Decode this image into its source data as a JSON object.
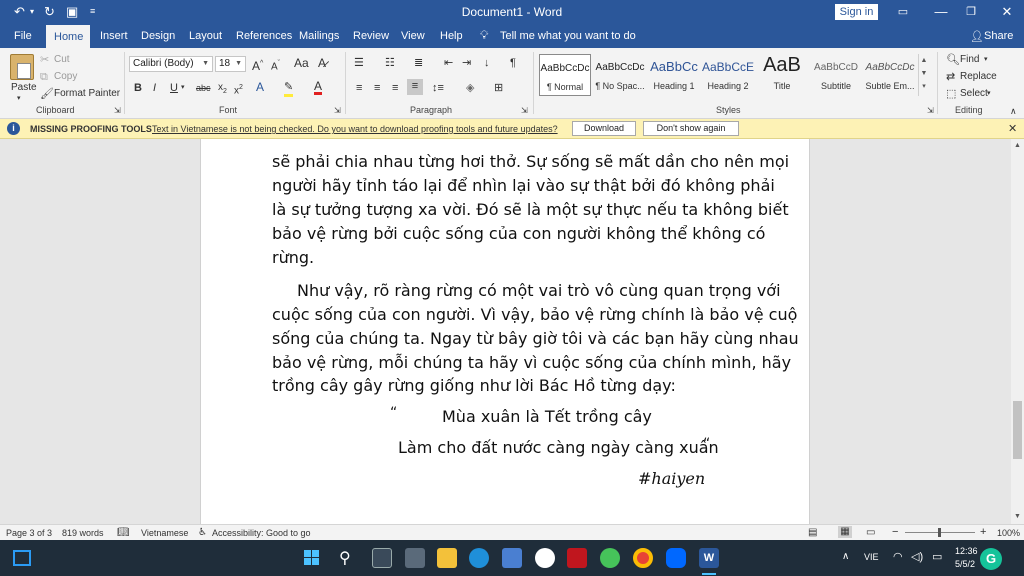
{
  "titlebar": {
    "title": "Document1 - Word",
    "signin_label": "Sign in"
  },
  "tabs": [
    "File",
    "Home",
    "Insert",
    "Design",
    "Layout",
    "References",
    "Mailings",
    "Review",
    "View",
    "Help"
  ],
  "tell_me": "Tell me what you want to do",
  "share_label": "Share",
  "clipboard": {
    "paste": "Paste",
    "cut": "Cut",
    "copy": "Copy",
    "format_painter": "Format Painter",
    "group_label": "Clipboard"
  },
  "font": {
    "family": "Calibri (Body)",
    "size": "18",
    "group_label": "Font"
  },
  "paragraph": {
    "group_label": "Paragraph"
  },
  "styles": {
    "items": [
      {
        "preview": "AaBbCcDc",
        "name": "¶ Normal"
      },
      {
        "preview": "AaBbCcDc",
        "name": "¶ No Spac..."
      },
      {
        "preview": "AaBbCc",
        "name": "Heading 1"
      },
      {
        "preview": "AaBbCcE",
        "name": "Heading 2"
      },
      {
        "preview": "AaB",
        "name": "Title"
      },
      {
        "preview": "AaBbCcD",
        "name": "Subtitle"
      },
      {
        "preview": "AaBbCcDc",
        "name": "Subtle Em..."
      }
    ],
    "group_label": "Styles"
  },
  "editing": {
    "find": "Find",
    "replace": "Replace",
    "select": "Select",
    "group_label": "Editing"
  },
  "infobar": {
    "title": "MISSING PROOFING TOOLS",
    "message": "Text in Vietnamese is not being checked. Do you want to download proofing tools and future updates?",
    "download": "Download",
    "dont_show": "Don't show again"
  },
  "document": {
    "lines": [
      "sẽ phải chia nhau từng hơi thở. Sự sống sẽ mất dần cho nên mọi",
      "người hãy tỉnh táo lại để nhìn lại vào sự thật bởi đó không phải",
      "là sự tưởng tượng xa vời. Đó sẽ là một sự thực nếu ta không biết",
      "bảo vệ rừng bởi cuộc sống của con người không thể không có",
      "rừng.",
      "Như vậy, rõ ràng rừng có một vai trò vô cùng quan trọng với",
      "cuộc sống của con người. Vì vậy, bảo vệ rừng chính là bảo vệ cuộ",
      "sống của chúng ta. Ngay từ bây giờ tôi và các bạn hãy cùng nhau",
      "bảo vệ rừng, mỗi chúng ta hãy vì cuộc sống của chính mình, hãy",
      "trồng cây gây rừng giống như lời Bác Hồ từng dạy:"
    ],
    "quote_open": "“",
    "quote_line1": "Mùa xuân là Tết trồng cây",
    "quote_line2": "Làm cho đất nước càng ngày càng xuân",
    "quote_close": "“",
    "signature": "#haiyen"
  },
  "statusbar": {
    "page": "Page 3 of 3",
    "words": "819 words",
    "language": "Vietnamese",
    "accessibility": "Accessibility: Good to go",
    "zoom": "100%"
  },
  "taskbar": {
    "lang": "VIE",
    "time": "12:36",
    "date": "5/5/2"
  }
}
